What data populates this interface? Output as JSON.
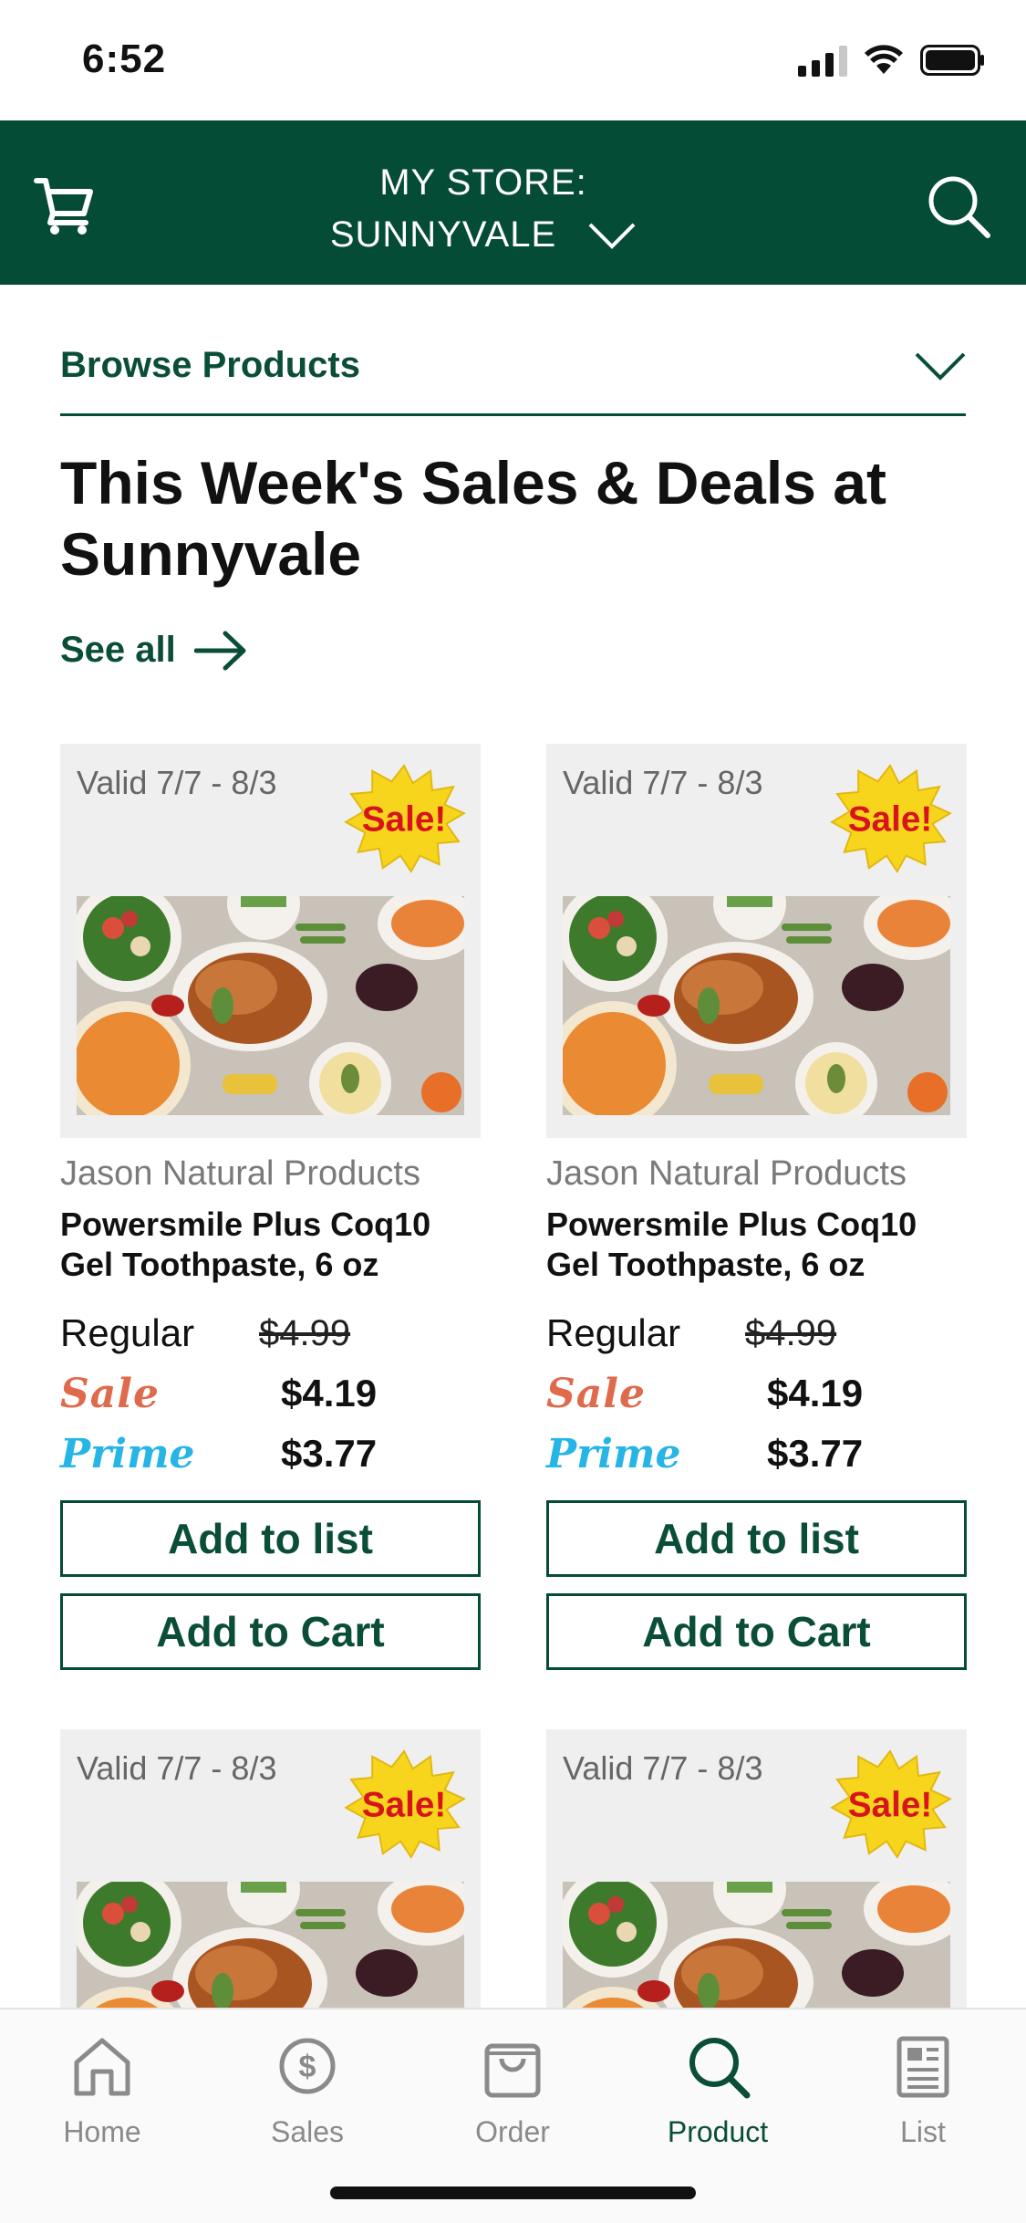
{
  "status_bar": {
    "time": "6:52"
  },
  "header": {
    "store_line1": "MY STORE:",
    "store_line2": "SUNNYVALE",
    "bg_color": "#054c36"
  },
  "browse": {
    "label": "Browse Products"
  },
  "page": {
    "title": "This Week's Sales & Deals at Sunnyvale",
    "see_all": "See all"
  },
  "products": [
    {
      "valid": "Valid 7/7 - 8/3",
      "badge": "Sale!",
      "brand": "Jason Natural Products",
      "name_line1": "Powersmile Plus Coq10",
      "name_line2": "Gel Toothpaste, 6 oz",
      "regular_label": "Regular",
      "regular_price": "$4.99",
      "sale_label": "Sale",
      "sale_price": "$4.19",
      "prime_label": "Prime",
      "prime_price": "$3.77",
      "add_list": "Add to list",
      "add_cart": "Add to Cart"
    },
    {
      "valid": "Valid 7/7 - 8/3",
      "badge": "Sale!",
      "brand": "Jason Natural Products",
      "name_line1": "Powersmile Plus Coq10",
      "name_line2": "Gel Toothpaste, 6 oz",
      "regular_label": "Regular",
      "regular_price": "$4.99",
      "sale_label": "Sale",
      "sale_price": "$4.19",
      "prime_label": "Prime",
      "prime_price": "$3.77",
      "add_list": "Add to list",
      "add_cart": "Add to Cart"
    },
    {
      "valid": "Valid 7/7 - 8/3",
      "badge": "Sale!"
    },
    {
      "valid": "Valid 7/7 - 8/3",
      "badge": "Sale!"
    }
  ],
  "tabs": [
    {
      "label": "Home",
      "icon": "home-icon"
    },
    {
      "label": "Sales",
      "icon": "dollar-coin-icon"
    },
    {
      "label": "Order",
      "icon": "shopping-bag-icon"
    },
    {
      "label": "Product",
      "icon": "search-icon",
      "active": true
    },
    {
      "label": "List",
      "icon": "list-document-icon"
    }
  ],
  "colors": {
    "accent": "#054c36",
    "sale": "#e06a4c",
    "prime": "#27b5e6",
    "badge_yellow": "#f7d51c",
    "badge_red": "#d7141c"
  }
}
